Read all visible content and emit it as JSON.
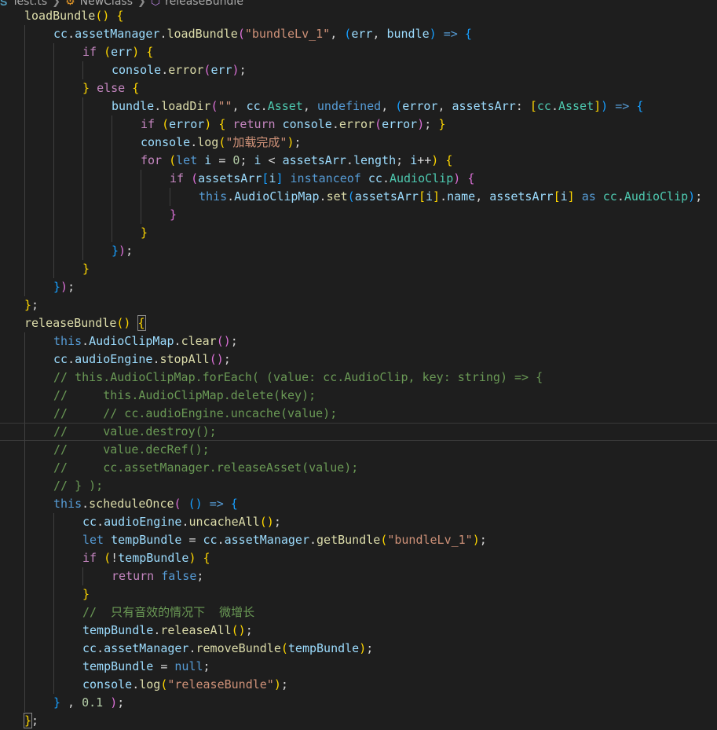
{
  "breadcrumb": {
    "file_icon": "ts-file-icon",
    "file": "Test.ts",
    "class_icon": "class-icon",
    "class": "NewClass",
    "method_icon": "method-icon",
    "method": "releaseBundle"
  },
  "colors": {
    "background": "#1e1e1e",
    "keyword": "#569cd6",
    "control": "#c586c0",
    "function": "#dcdcaa",
    "variable": "#9cdcfe",
    "type": "#4ec9b0",
    "string": "#ce9178",
    "number": "#b5cea8",
    "comment": "#6a9955",
    "bracket_1": "#ffd700",
    "bracket_2": "#da70d6",
    "bracket_3": "#179fff"
  },
  "code_lines": [
    {
      "i": 0,
      "t": [
        [
          "f",
          "loadBundle"
        ],
        [
          "b1",
          "()"
        ],
        [
          "p",
          " "
        ],
        [
          "b1",
          "{"
        ]
      ]
    },
    {
      "i": 1,
      "t": [
        [
          "v",
          "cc"
        ],
        [
          "p",
          "."
        ],
        [
          "v",
          "assetManager"
        ],
        [
          "p",
          "."
        ],
        [
          "f",
          "loadBundle"
        ],
        [
          "b2",
          "("
        ],
        [
          "s",
          "\"bundleLv_1\""
        ],
        [
          "p",
          ", "
        ],
        [
          "b3",
          "("
        ],
        [
          "v",
          "err"
        ],
        [
          "p",
          ", "
        ],
        [
          "v",
          "bundle"
        ],
        [
          "b3",
          ")"
        ],
        [
          "p",
          " "
        ],
        [
          "k",
          "=>"
        ],
        [
          "p",
          " "
        ],
        [
          "b3",
          "{"
        ]
      ]
    },
    {
      "i": 2,
      "t": [
        [
          "c",
          "if"
        ],
        [
          "p",
          " "
        ],
        [
          "b1",
          "("
        ],
        [
          "v",
          "err"
        ],
        [
          "b1",
          ")"
        ],
        [
          "p",
          " "
        ],
        [
          "b1",
          "{"
        ]
      ]
    },
    {
      "i": 3,
      "t": [
        [
          "v",
          "console"
        ],
        [
          "p",
          "."
        ],
        [
          "f",
          "error"
        ],
        [
          "b2",
          "("
        ],
        [
          "v",
          "err"
        ],
        [
          "b2",
          ")"
        ],
        [
          "p",
          ";"
        ]
      ]
    },
    {
      "i": 2,
      "t": [
        [
          "b1",
          "}"
        ],
        [
          "p",
          " "
        ],
        [
          "c",
          "else"
        ],
        [
          "p",
          " "
        ],
        [
          "b1",
          "{"
        ]
      ]
    },
    {
      "i": 3,
      "t": [
        [
          "v",
          "bundle"
        ],
        [
          "p",
          "."
        ],
        [
          "f",
          "loadDir"
        ],
        [
          "b2",
          "("
        ],
        [
          "s",
          "\"\""
        ],
        [
          "p",
          ", "
        ],
        [
          "v",
          "cc"
        ],
        [
          "p",
          "."
        ],
        [
          "t",
          "Asset"
        ],
        [
          "p",
          ", "
        ],
        [
          "k",
          "undefined"
        ],
        [
          "p",
          ", "
        ],
        [
          "b3",
          "("
        ],
        [
          "v",
          "error"
        ],
        [
          "p",
          ", "
        ],
        [
          "v",
          "assetsArr"
        ],
        [
          "p",
          ": "
        ],
        [
          "b1",
          "["
        ],
        [
          "t",
          "cc"
        ],
        [
          "p",
          "."
        ],
        [
          "t",
          "Asset"
        ],
        [
          "b1",
          "]"
        ],
        [
          "b3",
          ")"
        ],
        [
          "p",
          " "
        ],
        [
          "k",
          "=>"
        ],
        [
          "p",
          " "
        ],
        [
          "b3",
          "{"
        ]
      ]
    },
    {
      "i": 4,
      "t": [
        [
          "c",
          "if"
        ],
        [
          "p",
          " "
        ],
        [
          "b1",
          "("
        ],
        [
          "v",
          "error"
        ],
        [
          "b1",
          ")"
        ],
        [
          "p",
          " "
        ],
        [
          "b1",
          "{"
        ],
        [
          "p",
          " "
        ],
        [
          "c",
          "return"
        ],
        [
          "p",
          " "
        ],
        [
          "v",
          "console"
        ],
        [
          "p",
          "."
        ],
        [
          "f",
          "error"
        ],
        [
          "b2",
          "("
        ],
        [
          "v",
          "error"
        ],
        [
          "b2",
          ")"
        ],
        [
          "p",
          "; "
        ],
        [
          "b1",
          "}"
        ]
      ]
    },
    {
      "i": 4,
      "t": [
        [
          "v",
          "console"
        ],
        [
          "p",
          "."
        ],
        [
          "f",
          "log"
        ],
        [
          "b1",
          "("
        ],
        [
          "s",
          "\"加载完成\""
        ],
        [
          "b1",
          ")"
        ],
        [
          "p",
          ";"
        ]
      ]
    },
    {
      "i": 4,
      "t": [
        [
          "c",
          "for"
        ],
        [
          "p",
          " "
        ],
        [
          "b1",
          "("
        ],
        [
          "k",
          "let"
        ],
        [
          "p",
          " "
        ],
        [
          "v",
          "i"
        ],
        [
          "p",
          " = "
        ],
        [
          "n",
          "0"
        ],
        [
          "p",
          "; "
        ],
        [
          "v",
          "i"
        ],
        [
          "p",
          " < "
        ],
        [
          "v",
          "assetsArr"
        ],
        [
          "p",
          "."
        ],
        [
          "v",
          "length"
        ],
        [
          "p",
          "; "
        ],
        [
          "v",
          "i"
        ],
        [
          "p",
          "++"
        ],
        [
          "b1",
          ")"
        ],
        [
          "p",
          " "
        ],
        [
          "b1",
          "{"
        ]
      ]
    },
    {
      "i": 5,
      "t": [
        [
          "c",
          "if"
        ],
        [
          "p",
          " "
        ],
        [
          "b2",
          "("
        ],
        [
          "v",
          "assetsArr"
        ],
        [
          "b3",
          "["
        ],
        [
          "v",
          "i"
        ],
        [
          "b3",
          "]"
        ],
        [
          "p",
          " "
        ],
        [
          "k",
          "instanceof"
        ],
        [
          "p",
          " "
        ],
        [
          "v",
          "cc"
        ],
        [
          "p",
          "."
        ],
        [
          "t",
          "AudioClip"
        ],
        [
          "b2",
          ")"
        ],
        [
          "p",
          " "
        ],
        [
          "b2",
          "{"
        ]
      ]
    },
    {
      "i": 6,
      "t": [
        [
          "k",
          "this"
        ],
        [
          "p",
          "."
        ],
        [
          "v",
          "AudioClipMap"
        ],
        [
          "p",
          "."
        ],
        [
          "f",
          "set"
        ],
        [
          "b3",
          "("
        ],
        [
          "v",
          "assetsArr"
        ],
        [
          "b1",
          "["
        ],
        [
          "v",
          "i"
        ],
        [
          "b1",
          "]"
        ],
        [
          "p",
          "."
        ],
        [
          "v",
          "name"
        ],
        [
          "p",
          ", "
        ],
        [
          "v",
          "assetsArr"
        ],
        [
          "b1",
          "["
        ],
        [
          "v",
          "i"
        ],
        [
          "b1",
          "]"
        ],
        [
          "p",
          " "
        ],
        [
          "k",
          "as"
        ],
        [
          "p",
          " "
        ],
        [
          "t",
          "cc"
        ],
        [
          "p",
          "."
        ],
        [
          "t",
          "AudioClip"
        ],
        [
          "b3",
          ")"
        ],
        [
          "p",
          ";"
        ]
      ]
    },
    {
      "i": 5,
      "t": [
        [
          "b2",
          "}"
        ]
      ]
    },
    {
      "i": 4,
      "t": [
        [
          "b1",
          "}"
        ]
      ]
    },
    {
      "i": 3,
      "t": [
        [
          "b3",
          "}"
        ],
        [
          "b2",
          ")"
        ],
        [
          "p",
          ";"
        ]
      ]
    },
    {
      "i": 2,
      "t": [
        [
          "b1",
          "}"
        ]
      ]
    },
    {
      "i": 1,
      "t": [
        [
          "b3",
          "}"
        ],
        [
          "b2",
          ")"
        ],
        [
          "p",
          ";"
        ]
      ]
    },
    {
      "i": 0,
      "t": [
        [
          "b1",
          "}"
        ],
        [
          "p",
          ";"
        ]
      ]
    },
    {
      "i": 0,
      "t": [
        [
          "f",
          "releaseBundle"
        ],
        [
          "b1",
          "()"
        ],
        [
          "p",
          " "
        ],
        [
          "bm",
          "{"
        ]
      ]
    },
    {
      "i": 1,
      "t": [
        [
          "k",
          "this"
        ],
        [
          "p",
          "."
        ],
        [
          "v",
          "AudioClipMap"
        ],
        [
          "p",
          "."
        ],
        [
          "f",
          "clear"
        ],
        [
          "b2",
          "()"
        ],
        [
          "p",
          ";"
        ]
      ]
    },
    {
      "i": 1,
      "t": [
        [
          "v",
          "cc"
        ],
        [
          "p",
          "."
        ],
        [
          "v",
          "audioEngine"
        ],
        [
          "p",
          "."
        ],
        [
          "f",
          "stopAll"
        ],
        [
          "b2",
          "()"
        ],
        [
          "p",
          ";"
        ]
      ]
    },
    {
      "i": 1,
      "t": [
        [
          "m",
          "// this.AudioClipMap.forEach( (value: cc.AudioClip, key: string) => {"
        ]
      ]
    },
    {
      "i": 1,
      "t": [
        [
          "m",
          "//     this.AudioClipMap.delete(key);"
        ]
      ]
    },
    {
      "i": 1,
      "t": [
        [
          "m",
          "//     // cc.audioEngine.uncache(value);"
        ]
      ]
    },
    {
      "i": 1,
      "cur": true,
      "t": [
        [
          "m",
          "//     value.destroy();"
        ]
      ]
    },
    {
      "i": 1,
      "t": [
        [
          "m",
          "//     value.decRef();"
        ]
      ]
    },
    {
      "i": 1,
      "t": [
        [
          "m",
          "//     cc.assetManager.releaseAsset(value);"
        ]
      ]
    },
    {
      "i": 1,
      "t": [
        [
          "m",
          "// } );"
        ]
      ]
    },
    {
      "i": 1,
      "t": [
        [
          "k",
          "this"
        ],
        [
          "p",
          "."
        ],
        [
          "f",
          "scheduleOnce"
        ],
        [
          "b2",
          "("
        ],
        [
          "p",
          " "
        ],
        [
          "b3",
          "()"
        ],
        [
          "p",
          " "
        ],
        [
          "k",
          "=>"
        ],
        [
          "p",
          " "
        ],
        [
          "b3",
          "{"
        ]
      ]
    },
    {
      "i": 2,
      "t": [
        [
          "v",
          "cc"
        ],
        [
          "p",
          "."
        ],
        [
          "v",
          "audioEngine"
        ],
        [
          "p",
          "."
        ],
        [
          "f",
          "uncacheAll"
        ],
        [
          "b1",
          "()"
        ],
        [
          "p",
          ";"
        ]
      ]
    },
    {
      "i": 2,
      "t": [
        [
          "k",
          "let"
        ],
        [
          "p",
          " "
        ],
        [
          "v",
          "tempBundle"
        ],
        [
          "p",
          " = "
        ],
        [
          "v",
          "cc"
        ],
        [
          "p",
          "."
        ],
        [
          "v",
          "assetManager"
        ],
        [
          "p",
          "."
        ],
        [
          "f",
          "getBundle"
        ],
        [
          "b1",
          "("
        ],
        [
          "s",
          "\"bundleLv_1\""
        ],
        [
          "b1",
          ")"
        ],
        [
          "p",
          ";"
        ]
      ]
    },
    {
      "i": 2,
      "t": [
        [
          "c",
          "if"
        ],
        [
          "p",
          " "
        ],
        [
          "b1",
          "("
        ],
        [
          "p",
          "!"
        ],
        [
          "v",
          "tempBundle"
        ],
        [
          "b1",
          ")"
        ],
        [
          "p",
          " "
        ],
        [
          "b1",
          "{"
        ]
      ]
    },
    {
      "i": 3,
      "t": [
        [
          "c",
          "return"
        ],
        [
          "p",
          " "
        ],
        [
          "k",
          "false"
        ],
        [
          "p",
          ";"
        ]
      ]
    },
    {
      "i": 2,
      "t": [
        [
          "b1",
          "}"
        ]
      ]
    },
    {
      "i": 2,
      "t": [
        [
          "m",
          "//  只有音效的情况下  微增长"
        ]
      ]
    },
    {
      "i": 2,
      "t": [
        [
          "v",
          "tempBundle"
        ],
        [
          "p",
          "."
        ],
        [
          "f",
          "releaseAll"
        ],
        [
          "b1",
          "()"
        ],
        [
          "p",
          ";"
        ]
      ]
    },
    {
      "i": 2,
      "t": [
        [
          "v",
          "cc"
        ],
        [
          "p",
          "."
        ],
        [
          "v",
          "assetManager"
        ],
        [
          "p",
          "."
        ],
        [
          "f",
          "removeBundle"
        ],
        [
          "b1",
          "("
        ],
        [
          "v",
          "tempBundle"
        ],
        [
          "b1",
          ")"
        ],
        [
          "p",
          ";"
        ]
      ]
    },
    {
      "i": 2,
      "t": [
        [
          "v",
          "tempBundle"
        ],
        [
          "p",
          " = "
        ],
        [
          "k",
          "null"
        ],
        [
          "p",
          ";"
        ]
      ]
    },
    {
      "i": 2,
      "t": [
        [
          "v",
          "console"
        ],
        [
          "p",
          "."
        ],
        [
          "f",
          "log"
        ],
        [
          "b1",
          "("
        ],
        [
          "s",
          "\"releaseBundle\""
        ],
        [
          "b1",
          ")"
        ],
        [
          "p",
          ";"
        ]
      ]
    },
    {
      "i": 1,
      "t": [
        [
          "b3",
          "}"
        ],
        [
          "p",
          " , "
        ],
        [
          "n",
          "0.1"
        ],
        [
          "p",
          " "
        ],
        [
          "b2",
          ")"
        ],
        [
          "p",
          ";"
        ]
      ]
    },
    {
      "i": 0,
      "t": [
        [
          "bm",
          "}"
        ],
        [
          "p",
          ";"
        ]
      ]
    }
  ]
}
